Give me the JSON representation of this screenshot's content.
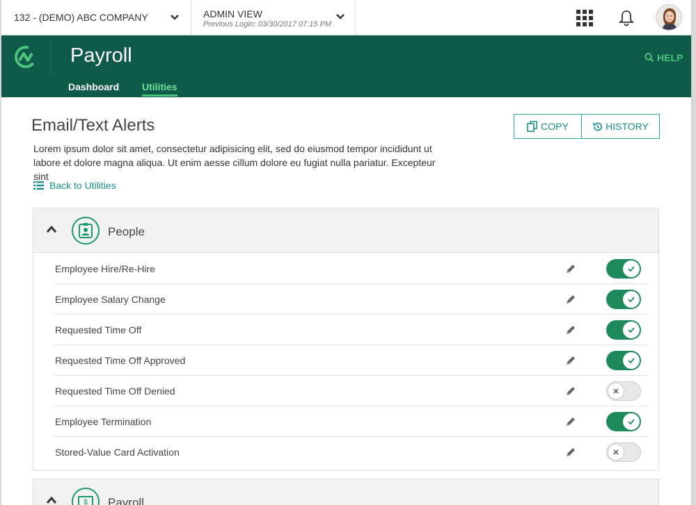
{
  "topbar": {
    "company": "132 - (DEMO) ABC COMPANY",
    "admin_title": "ADMIN VIEW",
    "previous_login": "Previous Login: 03/30/2017 07:15 PM"
  },
  "header": {
    "app_title": "Payroll",
    "help": "HELP",
    "tabs": [
      {
        "label": "Dashboard",
        "active": false
      },
      {
        "label": "Utilities",
        "active": true
      }
    ]
  },
  "page": {
    "title": "Email/Text Alerts",
    "copy_label": "COPY",
    "history_label": "HISTORY",
    "description": "Lorem ipsum dolor sit amet, consectetur adipisicing elit, sed do eiusmod tempor incididunt ut labore et dolore magna aliqua. Ut enim aesse cillum dolore eu fugiat nulla pariatur. Excepteur sint",
    "back_link": "Back to Utilities"
  },
  "sections": [
    {
      "title": "People",
      "icon": "id-badge-icon",
      "expanded": true,
      "alerts": [
        {
          "label": "Employee Hire/Re-Hire",
          "enabled": true
        },
        {
          "label": "Employee Salary Change",
          "enabled": true
        },
        {
          "label": "Requested Time Off",
          "enabled": true
        },
        {
          "label": "Requested Time Off Approved",
          "enabled": true
        },
        {
          "label": "Requested Time Off Denied",
          "enabled": false
        },
        {
          "label": "Employee Termination",
          "enabled": true
        },
        {
          "label": "Stored-Value Card Activation",
          "enabled": false
        }
      ]
    },
    {
      "title": "Payroll",
      "icon": "money-icon",
      "expanded": true
    }
  ],
  "colors": {
    "header_bg": "#0f5a48",
    "accent_green": "#4cc47d",
    "toggle_on": "#1e8a5c",
    "teal": "#1a8d8a"
  }
}
